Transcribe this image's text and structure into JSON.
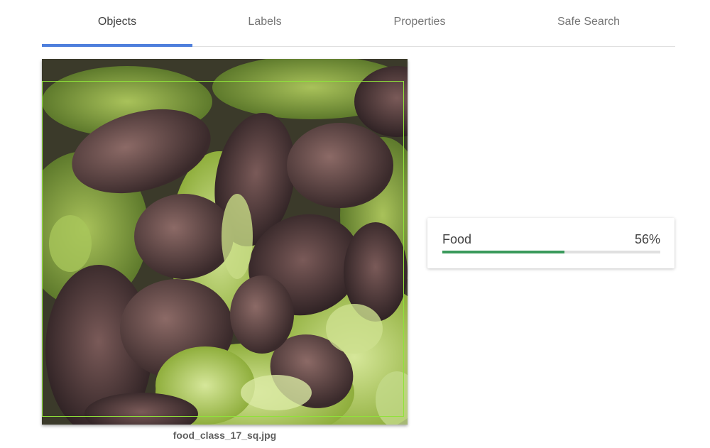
{
  "tabs": [
    {
      "label": "Objects",
      "active": true
    },
    {
      "label": "Labels",
      "active": false
    },
    {
      "label": "Properties",
      "active": false
    },
    {
      "label": "Safe Search",
      "active": false
    }
  ],
  "image": {
    "filename": "food_class_17_sq.jpg",
    "subject": "red and green leaf lettuce close-up"
  },
  "objects": [
    {
      "name": "Food",
      "score_text": "56%",
      "score": 0.56
    }
  ],
  "colors": {
    "accent": "#4e7fdc",
    "bar_fill": "#3a9a5b",
    "bar_track": "#e0e0e0",
    "bbox": "#8fe33a"
  }
}
